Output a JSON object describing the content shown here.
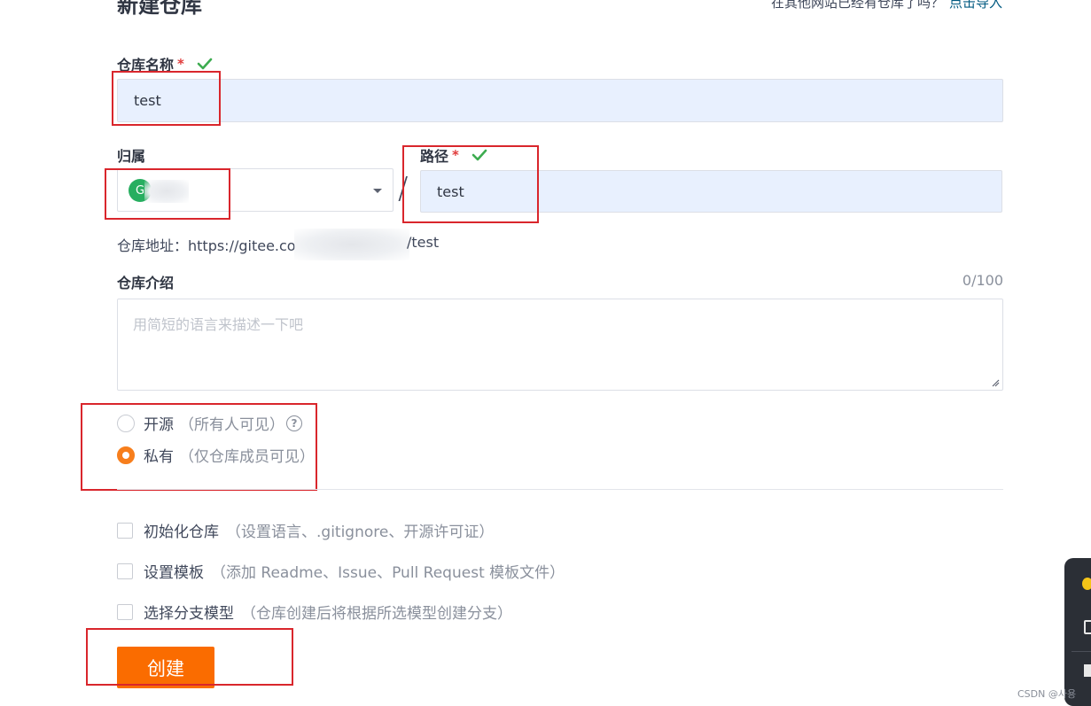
{
  "header": {
    "title": "新建仓库",
    "import_hint": "在其他网站已经有仓库了吗？",
    "import_link": "点击导入"
  },
  "repo_name": {
    "label": "仓库名称",
    "required_mark": "*",
    "value": "test"
  },
  "owner": {
    "label": "归属",
    "avatar_letter": "G"
  },
  "path": {
    "label": "路径",
    "required_mark": "*",
    "value": "test",
    "separator": "/"
  },
  "repo_url": {
    "prefix": "仓库地址：https://gitee.co",
    "suffix": "/test"
  },
  "description": {
    "label": "仓库介绍",
    "counter": "0/100",
    "placeholder": "用简短的语言来描述一下吧"
  },
  "visibility": {
    "options": [
      {
        "label": "开源",
        "hint": "（所有人可见）",
        "checked": false
      },
      {
        "label": "私有",
        "hint": "（仅仓库成员可见）",
        "checked": true
      }
    ],
    "help_symbol": "?"
  },
  "init_options": [
    {
      "label": "初始化仓库",
      "hint": "（设置语言、.gitignore、开源许可证）"
    },
    {
      "label": "设置模板",
      "hint": "（添加 Readme、Issue、Pull Request 模板文件）"
    },
    {
      "label": "选择分支模型",
      "hint": "（仓库创建后将根据所选模型创建分支）"
    }
  ],
  "submit": {
    "label": "创建"
  },
  "watermark": "CSDN @사용",
  "colors": {
    "accent": "#fa6c00",
    "radio_checked": "#f77e1c",
    "check_green": "#3dac50",
    "annotation_red": "#d9262c",
    "input_fill": "#e8f0fe"
  }
}
